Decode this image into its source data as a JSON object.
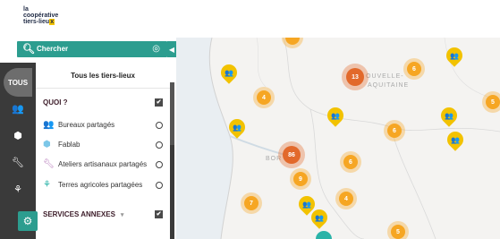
{
  "logo": {
    "line1": "la",
    "line2": "coopérative",
    "line3": "tiers-lieu",
    "line3_highlight": "x"
  },
  "search": {
    "label": "Chercher",
    "toggle": "◀"
  },
  "rail": {
    "tous_label": "TOUS"
  },
  "panel": {
    "title": "Tous les tiers-lieux",
    "section1": {
      "label": "QUOI ?",
      "checked": "✔"
    },
    "categories": [
      {
        "label": "Bureaux partagés",
        "icon": "people-icon",
        "color": "#f2c200"
      },
      {
        "label": "Fablab",
        "icon": "cube-icon",
        "color": "#7cc7e8"
      },
      {
        "label": "Ateliers artisanaux partagés",
        "icon": "wrench-icon",
        "color": "#b06fb5"
      },
      {
        "label": "Terres agricoles partagées",
        "icon": "plant-icon",
        "color": "#2ab3a8"
      }
    ],
    "section2": {
      "label": "SERVICES ANNEXES",
      "checked": "✔"
    }
  },
  "map": {
    "region_label_1": "OUVELLE-",
    "region_label_2": "AQUITAINE",
    "city_label": "BOR",
    "clusters": [
      {
        "id": "c13",
        "value": "13"
      },
      {
        "id": "c6a",
        "value": "6"
      },
      {
        "id": "c4a",
        "value": "4"
      },
      {
        "id": "c6b",
        "value": "6"
      },
      {
        "id": "c86",
        "value": "86"
      },
      {
        "id": "c6c",
        "value": "6"
      },
      {
        "id": "c9",
        "value": "9"
      },
      {
        "id": "c7",
        "value": "7"
      },
      {
        "id": "c4b",
        "value": "4"
      },
      {
        "id": "c5a",
        "value": "5"
      },
      {
        "id": "c5b",
        "value": "5"
      }
    ]
  },
  "colors": {
    "accent": "#2c9d8f",
    "cluster": "#f6a623",
    "big_cluster": "#e2692b",
    "marker": "#f2c200"
  }
}
